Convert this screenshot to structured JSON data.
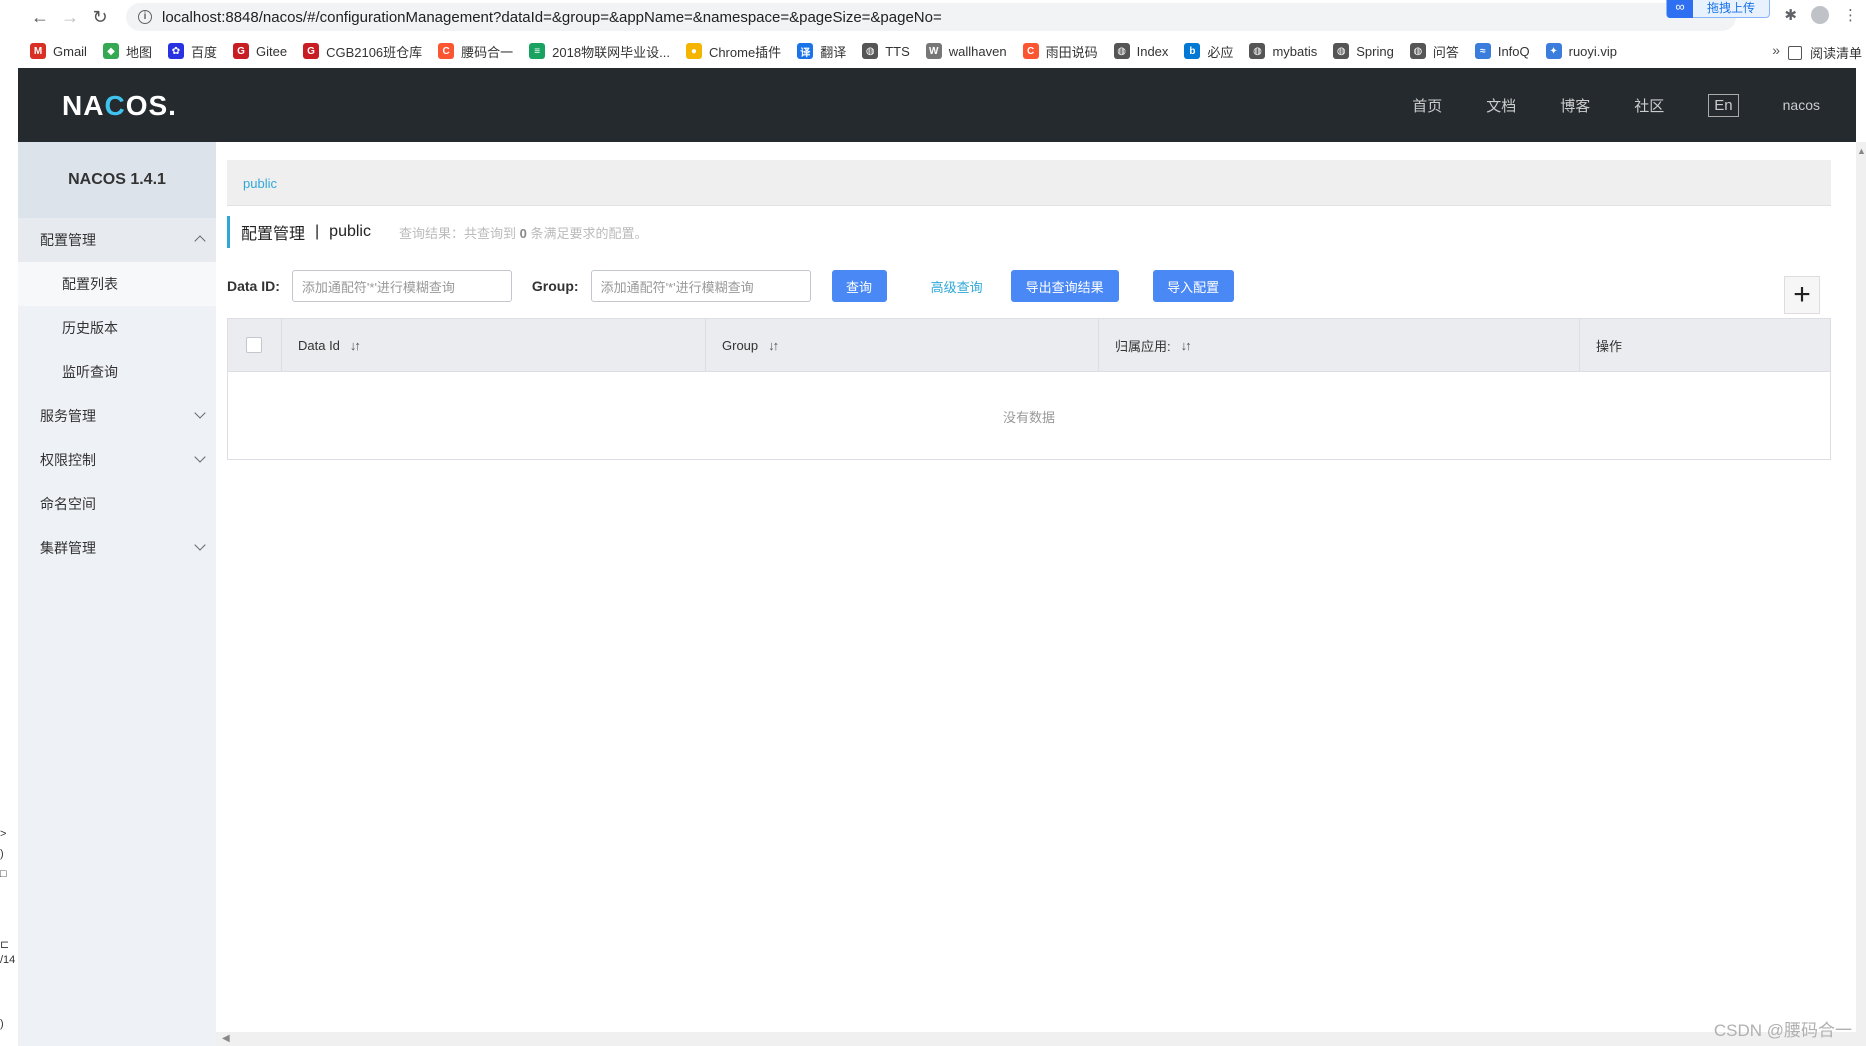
{
  "browser": {
    "url": "localhost:8848/nacos/#/configurationManagement?dataId=&group=&appName=&namespace=&pageSize=&pageNo=",
    "upload_label": "拖拽上传",
    "bookmarks": [
      {
        "label": "Gmail",
        "color": "#d93025",
        "glyph": "M"
      },
      {
        "label": "地图",
        "color": "#34a853",
        "glyph": "◆"
      },
      {
        "label": "百度",
        "color": "#2932e1",
        "glyph": "✿"
      },
      {
        "label": "Gitee",
        "color": "#c71d23",
        "glyph": "G"
      },
      {
        "label": "CGB2106班仓库",
        "color": "#c71d23",
        "glyph": "G"
      },
      {
        "label": "腰码合一",
        "color": "#fc5531",
        "glyph": "C"
      },
      {
        "label": "2018物联网毕业设...",
        "color": "#1aa260",
        "glyph": "≡"
      },
      {
        "label": "Chrome插件",
        "color": "#f4b400",
        "glyph": "●"
      },
      {
        "label": "翻译",
        "color": "#1a73e8",
        "glyph": "译"
      },
      {
        "label": "TTS",
        "color": "#555555",
        "glyph": "◍"
      },
      {
        "label": "wallhaven",
        "color": "#777777",
        "glyph": "W"
      },
      {
        "label": "雨田说码",
        "color": "#fc5531",
        "glyph": "C"
      },
      {
        "label": "Index",
        "color": "#555555",
        "glyph": "◍"
      },
      {
        "label": "必应",
        "color": "#0078d4",
        "glyph": "b"
      },
      {
        "label": "mybatis",
        "color": "#555555",
        "glyph": "◍"
      },
      {
        "label": "Spring",
        "color": "#555555",
        "glyph": "◍"
      },
      {
        "label": "问答",
        "color": "#555555",
        "glyph": "◍"
      },
      {
        "label": "InfoQ",
        "color": "#3b7ddd",
        "glyph": "≈"
      },
      {
        "label": "ruoyi.vip",
        "color": "#3b7ddd",
        "glyph": "✦"
      }
    ],
    "more": "»",
    "reading_list": "阅读清单"
  },
  "header": {
    "brand_pre": "NA",
    "brand_o": "C",
    "brand_post": "OS.",
    "nav": [
      "首页",
      "文档",
      "博客",
      "社区"
    ],
    "lang": "En",
    "user": "nacos"
  },
  "sidebar": {
    "title": "NACOS 1.4.1",
    "config_mgmt": "配置管理",
    "config_list": "配置列表",
    "history": "历史版本",
    "listen_query": "监听查询",
    "service_mgmt": "服务管理",
    "permission": "权限控制",
    "namespace": "命名空间",
    "cluster": "集群管理"
  },
  "main": {
    "namespace_tab": "public",
    "title": "配置管理",
    "title_sep": "|",
    "title_ns": "public",
    "result_pre": "查询结果：共查询到",
    "result_count": "0",
    "result_post": "条满足要求的配置。",
    "dataid_label": "Data ID:",
    "dataid_placeholder": "添加通配符'*'进行模糊查询",
    "group_label": "Group:",
    "group_placeholder": "添加通配符'*'进行模糊查询",
    "query_btn": "查询",
    "advanced_query": "高级查询",
    "export_btn": "导出查询结果",
    "import_btn": "导入配置",
    "plus": "+",
    "columns": [
      "Data Id",
      "Group",
      "归属应用:",
      "操作"
    ],
    "empty": "没有数据"
  },
  "watermark": "CSDN @腰码合一",
  "colors": {
    "primary": "#4a88f5",
    "link": "#2fa8d8",
    "header_bg": "#252a2f"
  }
}
